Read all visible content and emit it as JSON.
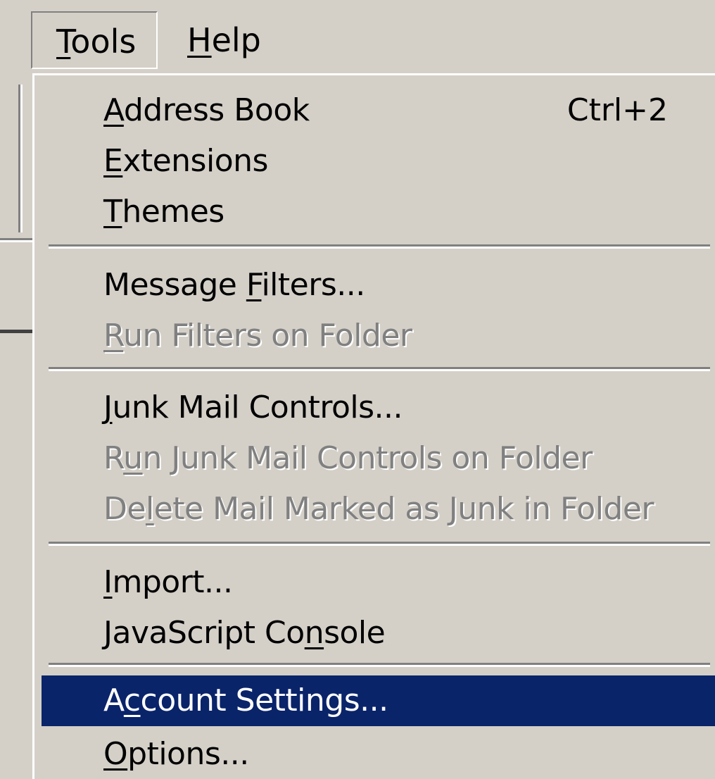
{
  "menubar": {
    "items": [
      {
        "label_underlined": "T",
        "label_rest": "ools"
      },
      {
        "label_underlined": "H",
        "label_rest": "elp"
      }
    ]
  },
  "dropdown": {
    "items": [
      {
        "pre": "",
        "u": "A",
        "post": "ddress Book",
        "accel": "Ctrl+2",
        "state": "enabled"
      },
      {
        "pre": "",
        "u": "E",
        "post": "xtensions",
        "accel": "",
        "state": "enabled"
      },
      {
        "pre": "",
        "u": "T",
        "post": "hemes",
        "accel": "",
        "state": "enabled"
      },
      {
        "pre": "Message ",
        "u": "F",
        "post": "ilters...",
        "accel": "",
        "state": "enabled"
      },
      {
        "pre": "",
        "u": "R",
        "post": "un Filters on Folder",
        "accel": "",
        "state": "disabled"
      },
      {
        "pre": "",
        "u": "J",
        "post": "unk Mail Controls...",
        "accel": "",
        "state": "enabled"
      },
      {
        "pre": "R",
        "u": "u",
        "post": "n Junk Mail Controls on Folder",
        "accel": "",
        "state": "disabled"
      },
      {
        "pre": "De",
        "u": "l",
        "post": "ete Mail Marked as Junk in Folder",
        "accel": "",
        "state": "disabled"
      },
      {
        "pre": "",
        "u": "I",
        "post": "mport...",
        "accel": "",
        "state": "enabled"
      },
      {
        "pre": "JavaScript Co",
        "u": "n",
        "post": "sole",
        "accel": "",
        "state": "enabled"
      },
      {
        "pre": "A",
        "u": "c",
        "post": "count Settings...",
        "accel": "",
        "state": "selected"
      },
      {
        "pre": "",
        "u": "O",
        "post": "ptions...",
        "accel": "",
        "state": "enabled"
      }
    ]
  }
}
